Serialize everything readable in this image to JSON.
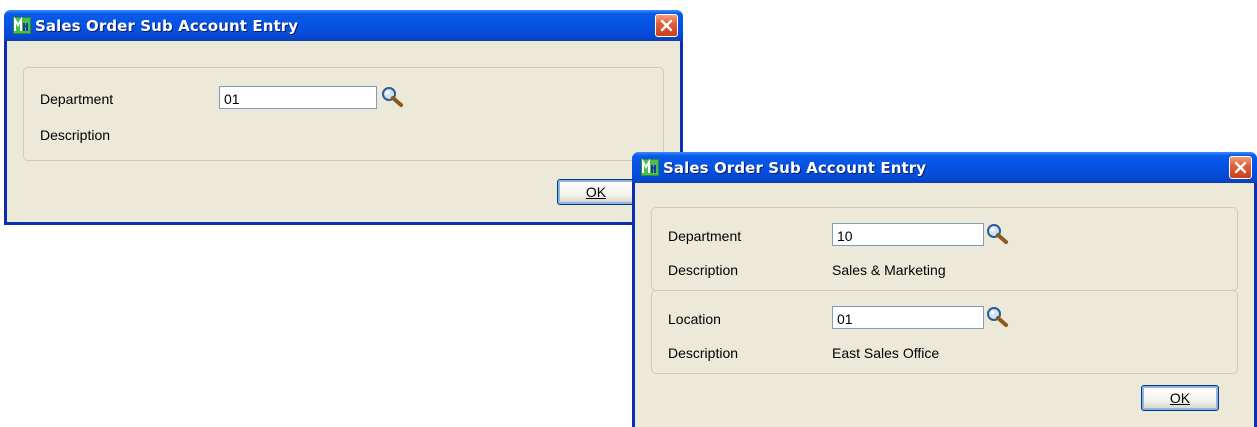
{
  "window1": {
    "title": "Sales Order Sub Account Entry",
    "department_label": "Department",
    "department_value": "01",
    "description_label": "Description",
    "description_value": "",
    "ok_label": "OK"
  },
  "window2": {
    "title": "Sales Order Sub Account Entry",
    "department_label": "Department",
    "department_value": "10",
    "department_description_label": "Description",
    "department_description_value": "Sales & Marketing",
    "location_label": "Location",
    "location_value": "01",
    "location_description_label": "Description",
    "location_description_value": "East Sales Office",
    "ok_label": "OK"
  },
  "icons": {
    "app": "app-icon",
    "close": "close-icon",
    "lookup": "magnifier-icon"
  },
  "colors": {
    "titlebar": "#0553e4",
    "client": "#ece9d8",
    "close": "#e0603c"
  }
}
